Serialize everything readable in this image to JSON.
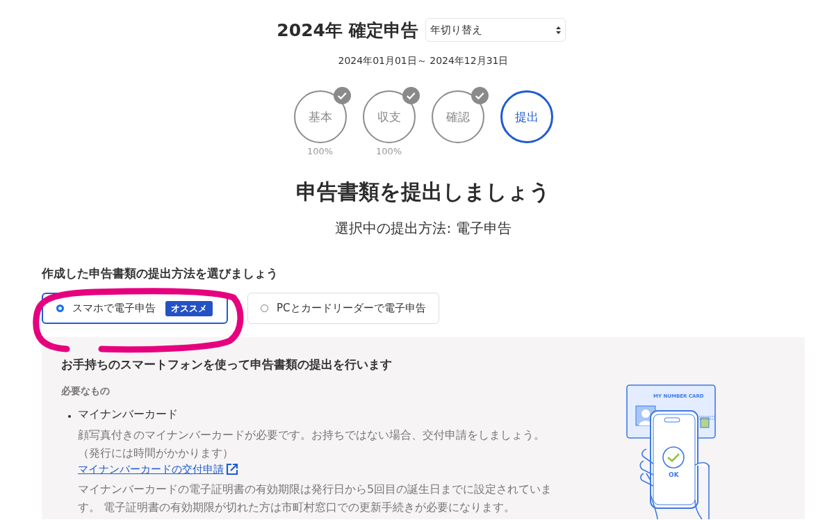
{
  "header": {
    "title": "2024年 確定申告",
    "year_select": {
      "value": "年切り替え"
    },
    "period": "2024年01月01日～ 2024年12月31日"
  },
  "steps": [
    {
      "label": "基本",
      "completed": true,
      "selected": false,
      "progress": "100%"
    },
    {
      "label": "収支",
      "completed": true,
      "selected": false,
      "progress": "100%"
    },
    {
      "label": "確認",
      "completed": true,
      "selected": false
    },
    {
      "label": "提出",
      "completed": false,
      "selected": true
    }
  ],
  "heading": "申告書類を提出しましょう",
  "subheading": "選択中の提出方法: 電子申告",
  "method_section": {
    "label": "作成した申告書類の提出方法を選びましょう",
    "options": [
      {
        "label": "スマホで電子申告",
        "badge": "オススメ",
        "selected": true
      },
      {
        "label": "PCとカードリーダーで電子申告",
        "selected": false
      }
    ]
  },
  "panel": {
    "title": "お手持ちのスマートフォンを使って申告書類の提出を行います",
    "requirements_label": "必要なもの",
    "items": [
      {
        "name": "マイナンバーカード",
        "description": "顔写真付きのマイナンバーカードが必要です。お持ちではない場合、交付申請をしましょう。（発行には時間がかかります）",
        "link": "マイナンバーカードの交付申請",
        "note": "マイナンバーカードの電子証明書の有効期限は発行日から5回目の誕生日までに設定されています。 電子証明書の有効期限が切れた方は市町村窓口での更新手続きが必要になります。"
      }
    ],
    "illustration": {
      "card_label": "MY NUMBER CARD",
      "ok_label": "OK"
    }
  }
}
